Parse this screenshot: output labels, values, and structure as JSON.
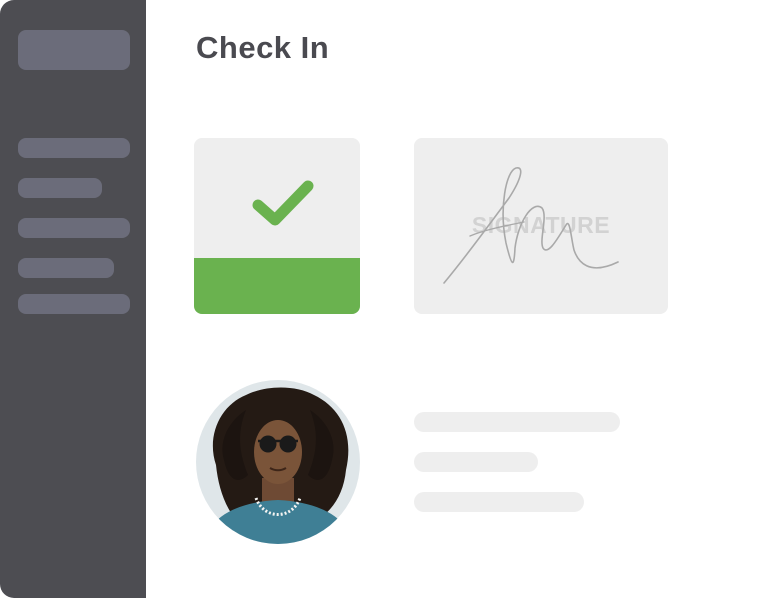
{
  "page": {
    "title": "Check In"
  },
  "check_card": {
    "icon": "checkmark-icon",
    "status_color": "#6ab24f"
  },
  "signature_card": {
    "label": "SIGNATURE"
  },
  "profile": {
    "avatar": "user-avatar-photo"
  },
  "colors": {
    "sidebar": "#4d4d52",
    "sidebar_placeholder": "#6b6c7a",
    "card": "#eeeeee",
    "accent_green": "#6ab24f",
    "title_text": "#4a4a50"
  }
}
